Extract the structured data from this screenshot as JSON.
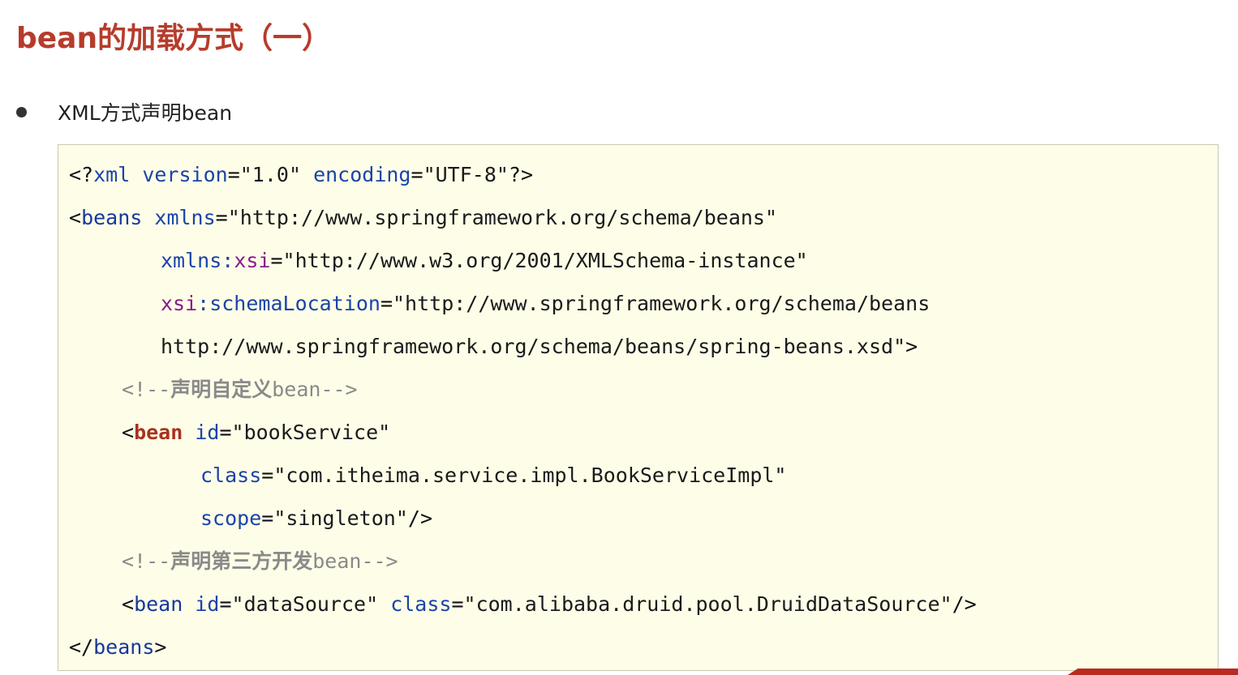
{
  "title": "bean的加载方式（一）",
  "bullet": {
    "text": "XML方式声明bean"
  },
  "code": {
    "lines": [
      {
        "xml_open": "<?",
        "xml_name": "xml",
        "attr_version": "version",
        "eq1": "=",
        "val_version": "\"1.0\"",
        "attr_encoding": "encoding",
        "eq2": "=",
        "val_encoding": "\"UTF-8\"",
        "xml_close": "?>"
      },
      {
        "lt": "<",
        "tag": "beans",
        "attr": "xmlns",
        "eq": "=",
        "value": "\"http://www.springframework.org/schema/beans\""
      },
      {
        "attr_prefix": "xmlns:",
        "attr_ns": "xsi",
        "eq": "=",
        "value": "\"http://www.w3.org/2001/XMLSchema-instance\""
      },
      {
        "attr_ns": "xsi",
        "attr_rest": ":schemaLocation",
        "eq": "=",
        "value": "\"http://www.springframework.org/schema/beans"
      },
      {
        "value": "http://www.springframework.org/schema/beans/spring-beans.xsd\"",
        "close": ">"
      },
      {
        "open": "<!--",
        "text": "声明自定义",
        "tail": "bean-->"
      },
      {
        "lt": "<",
        "tag": "bean",
        "attr": "id",
        "eq": "=",
        "value": "\"bookService\""
      },
      {
        "attr": "class",
        "eq": "=",
        "value": "\"com.itheima.service.impl.BookServiceImpl\""
      },
      {
        "attr": "scope",
        "eq": "=",
        "value": "\"singleton\"",
        "close": "/>"
      },
      {
        "open": "<!--",
        "text": "声明第三方开发",
        "tail": "bean-->"
      },
      {
        "lt": "<",
        "tag": "bean",
        "attr_id": "id",
        "eq1": "=",
        "val_id": "\"dataSource\"",
        "attr_class": "class",
        "eq2": "=",
        "val_class": "\"com.alibaba.druid.pool.DruidDataSource\"",
        "close": "/>"
      },
      {
        "lt": "</",
        "tag": "beans",
        "close": ">"
      }
    ]
  },
  "colors": {
    "title": "#b63c2c",
    "code_background": "#fefde8",
    "tag": "#15389c",
    "attribute": "#1a44a8",
    "namespace": "#871a8c",
    "bean_tag": "#a8321f",
    "comment": "#8a8a8a"
  }
}
